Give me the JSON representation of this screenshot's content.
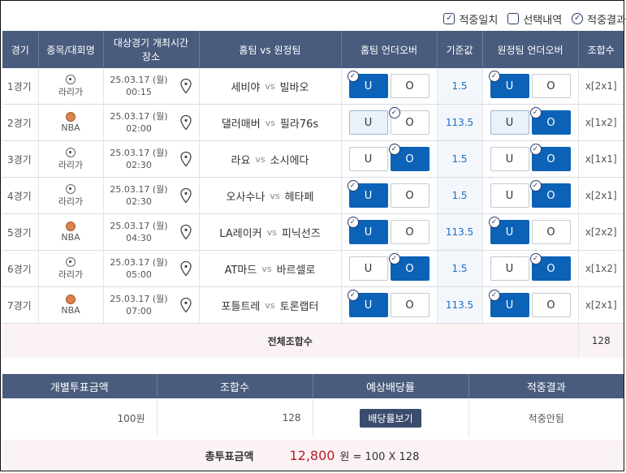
{
  "filters": [
    {
      "label": "적중일치",
      "checked": true,
      "shape": "square"
    },
    {
      "label": "선택내역",
      "checked": false,
      "shape": "square"
    },
    {
      "label": "적중결과",
      "checked": true,
      "shape": "circle"
    }
  ],
  "headers": {
    "game": "경기",
    "sport": "종목/대회명",
    "time_l1": "대상경기 개최시간",
    "time_l2": "장소",
    "teams": "홈팀 vs 원정팀",
    "home_ou": "홈팀 언더오버",
    "base": "기준값",
    "away_ou": "원정팀 언더오버",
    "combo": "조합수"
  },
  "vs": "vs",
  "u_label": "U",
  "o_label": "O",
  "games": [
    {
      "num": "1경기",
      "league": "라리가",
      "sport_icon": "soccer-ball-icon",
      "date": "25.03.17 (월)",
      "time": "00:15",
      "home": "세비야",
      "away": "빌바오",
      "base": "1.5",
      "combo": "x[2x1]",
      "hu": {
        "state": "on",
        "mark": true
      },
      "ho": {
        "state": "off",
        "mark": false
      },
      "au": {
        "state": "on",
        "mark": true
      },
      "ao": {
        "state": "off",
        "mark": false
      }
    },
    {
      "num": "2경기",
      "league": "NBA",
      "sport_icon": "basketball-icon",
      "date": "25.03.17 (월)",
      "time": "02:00",
      "home": "댈러매버",
      "away": "필라76s",
      "base": "113.5",
      "combo": "x[1x2]",
      "hu": {
        "state": "lite",
        "mark": false
      },
      "ho": {
        "state": "off",
        "mark": true
      },
      "au": {
        "state": "lite",
        "mark": false
      },
      "ao": {
        "state": "on",
        "mark": true
      }
    },
    {
      "num": "3경기",
      "league": "라리가",
      "sport_icon": "soccer-ball-icon",
      "date": "25.03.17 (월)",
      "time": "02:30",
      "home": "라요",
      "away": "소시에다",
      "base": "1.5",
      "combo": "x[1x1]",
      "hu": {
        "state": "off",
        "mark": false
      },
      "ho": {
        "state": "on",
        "mark": true
      },
      "au": {
        "state": "off",
        "mark": false
      },
      "ao": {
        "state": "on",
        "mark": true
      }
    },
    {
      "num": "4경기",
      "league": "라리가",
      "sport_icon": "soccer-ball-icon",
      "date": "25.03.17 (월)",
      "time": "02:30",
      "home": "오사수나",
      "away": "헤타페",
      "base": "1.5",
      "combo": "x[2x1]",
      "hu": {
        "state": "on",
        "mark": true
      },
      "ho": {
        "state": "off",
        "mark": false
      },
      "au": {
        "state": "off",
        "mark": false
      },
      "ao": {
        "state": "on",
        "mark": true
      }
    },
    {
      "num": "5경기",
      "league": "NBA",
      "sport_icon": "basketball-icon",
      "date": "25.03.17 (월)",
      "time": "04:30",
      "home": "LA레이커",
      "away": "피닉선즈",
      "base": "113.5",
      "combo": "x[2x2]",
      "hu": {
        "state": "on",
        "mark": true
      },
      "ho": {
        "state": "off",
        "mark": false
      },
      "au": {
        "state": "on",
        "mark": true
      },
      "ao": {
        "state": "off",
        "mark": false
      }
    },
    {
      "num": "6경기",
      "league": "라리가",
      "sport_icon": "soccer-ball-icon",
      "date": "25.03.17 (월)",
      "time": "05:00",
      "home": "AT마드",
      "away": "바르셀로",
      "base": "1.5",
      "combo": "x[1x2]",
      "hu": {
        "state": "off",
        "mark": false
      },
      "ho": {
        "state": "on",
        "mark": true
      },
      "au": {
        "state": "off",
        "mark": false
      },
      "ao": {
        "state": "on",
        "mark": true
      }
    },
    {
      "num": "7경기",
      "league": "NBA",
      "sport_icon": "basketball-icon",
      "date": "25.03.17 (월)",
      "time": "07:00",
      "home": "포틀트레",
      "away": "토론랩터",
      "base": "113.5",
      "combo": "x[2x1]",
      "hu": {
        "state": "on",
        "mark": true
      },
      "ho": {
        "state": "off",
        "mark": false
      },
      "au": {
        "state": "on",
        "mark": true
      },
      "ao": {
        "state": "off",
        "mark": false
      }
    }
  ],
  "total": {
    "label": "전체조합수",
    "value": "128"
  },
  "summary": {
    "headers": [
      "개별투표금액",
      "조합수",
      "예상배당률",
      "적중결과"
    ],
    "amount": "100원",
    "combos": "128",
    "odds_button": "배당률보기",
    "result": "적중안됨"
  },
  "grand": {
    "label": "총투표금액",
    "value": "12,800",
    "formula": "원 = 100 X 128"
  },
  "colors": {
    "header_bg": "#4a5c7e",
    "selected": "#0b62b6",
    "base_text": "#1a6fc4",
    "total_value": "#b41e2a"
  }
}
